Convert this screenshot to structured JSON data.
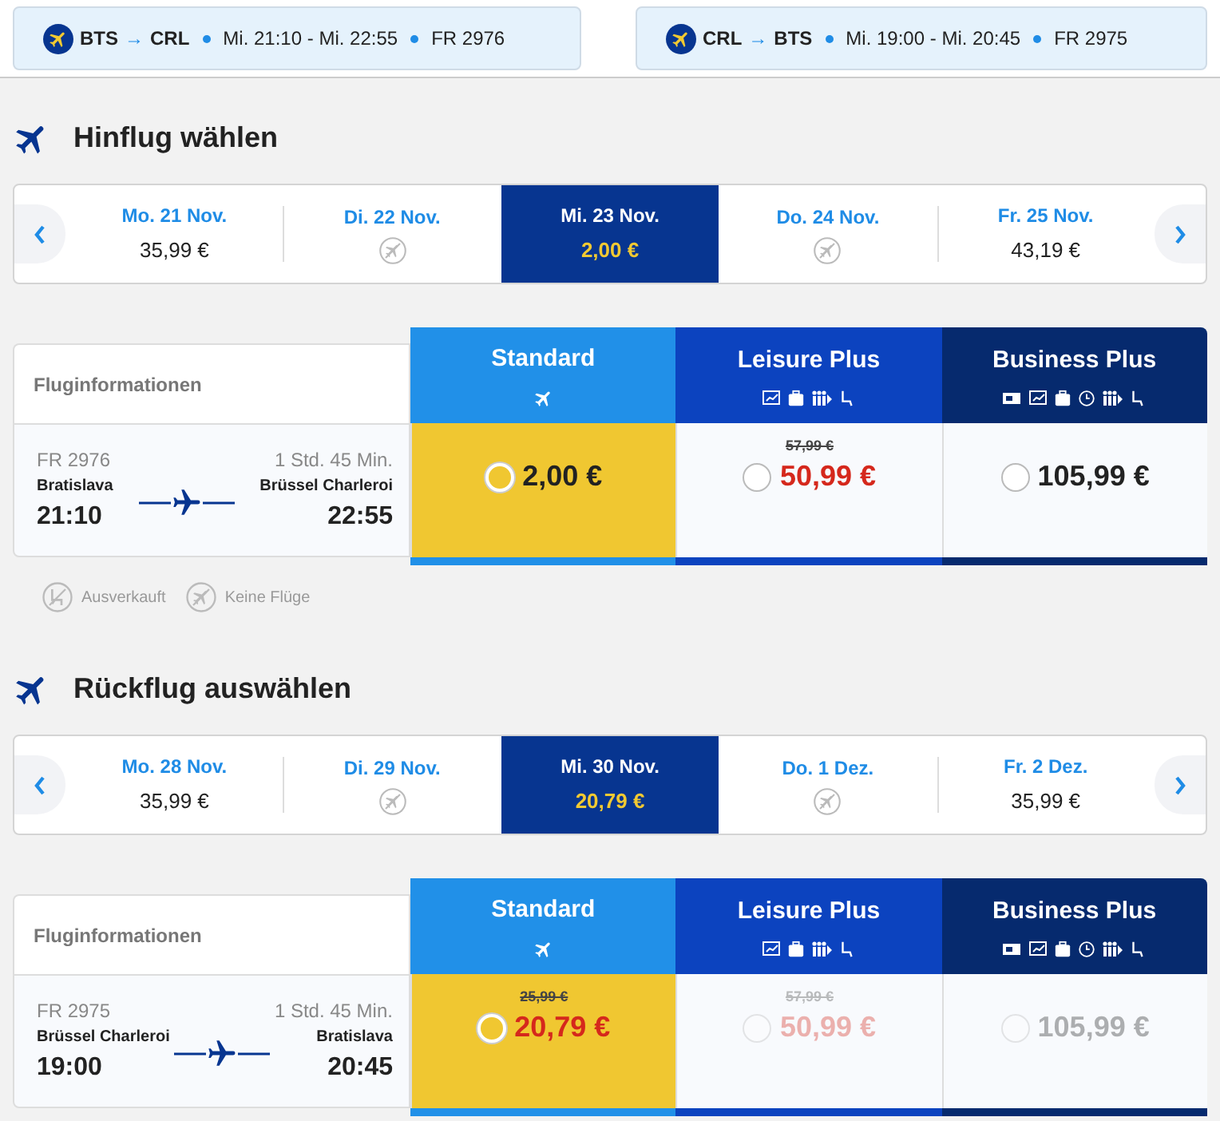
{
  "summary": [
    {
      "from": "BTS",
      "arrow": "→",
      "to": "CRL",
      "times": "Mi. 21:10 - Mi. 22:55",
      "flight": "FR 2976"
    },
    {
      "from": "CRL",
      "arrow": "→",
      "to": "BTS",
      "times": "Mi. 19:00 - Mi. 20:45",
      "flight": "FR 2975"
    }
  ],
  "sections": [
    {
      "title": "Hinflug wählen",
      "days": [
        {
          "label": "Mo. 21 Nov.",
          "price": "35,99 €",
          "no_flights": false,
          "selected": false
        },
        {
          "label": "Di. 22 Nov.",
          "no_flights": true,
          "selected": false
        },
        {
          "label": "Mi. 23 Nov.",
          "price": "2,00 €",
          "no_flights": false,
          "selected": true
        },
        {
          "label": "Do. 24 Nov.",
          "no_flights": true,
          "selected": false
        },
        {
          "label": "Fr. 25 Nov.",
          "price": "43,19 €",
          "no_flights": false,
          "selected": false
        }
      ],
      "info_heading": "Fluginformationen",
      "flight": {
        "number": "FR 2976",
        "duration": "1 Std. 45 Min.",
        "origin": "Bratislava",
        "destination": "Brüssel Charleroi",
        "departure": "21:10",
        "arrival": "22:55"
      },
      "fares": [
        {
          "kind": "standard",
          "name": "Standard",
          "price": "2,00 €",
          "selected": true,
          "disabled": false
        },
        {
          "kind": "leisure",
          "name": "Leisure Plus",
          "old_price": "57,99 €",
          "price": "50,99 €",
          "selected": false,
          "disabled": false
        },
        {
          "kind": "business",
          "name": "Business Plus",
          "price": "105,99 €",
          "selected": false,
          "disabled": false
        }
      ],
      "legend": [
        {
          "kind": "sold-out",
          "label": "Ausverkauft"
        },
        {
          "kind": "no-flights",
          "label": "Keine Flüge"
        }
      ]
    },
    {
      "title": "Rückflug auswählen",
      "days": [
        {
          "label": "Mo. 28 Nov.",
          "price": "35,99 €",
          "no_flights": false,
          "selected": false
        },
        {
          "label": "Di. 29 Nov.",
          "no_flights": true,
          "selected": false
        },
        {
          "label": "Mi. 30 Nov.",
          "price": "20,79 €",
          "no_flights": false,
          "selected": true
        },
        {
          "label": "Do. 1 Dez.",
          "no_flights": true,
          "selected": false
        },
        {
          "label": "Fr. 2 Dez.",
          "price": "35,99 €",
          "no_flights": false,
          "selected": false
        }
      ],
      "info_heading": "Fluginformationen",
      "flight": {
        "number": "FR 2975",
        "duration": "1 Std. 45 Min.",
        "origin": "Brüssel Charleroi",
        "destination": "Bratislava",
        "departure": "19:00",
        "arrival": "20:45"
      },
      "fares": [
        {
          "kind": "standard",
          "name": "Standard",
          "old_price": "25,99 €",
          "price": "20,79 €",
          "selected": true,
          "disabled": false
        },
        {
          "kind": "leisure",
          "name": "Leisure Plus",
          "old_price": "57,99 €",
          "price": "50,99 €",
          "selected": false,
          "disabled": true
        },
        {
          "kind": "business",
          "name": "Business Plus",
          "price": "105,99 €",
          "selected": false,
          "disabled": true
        }
      ]
    }
  ]
}
